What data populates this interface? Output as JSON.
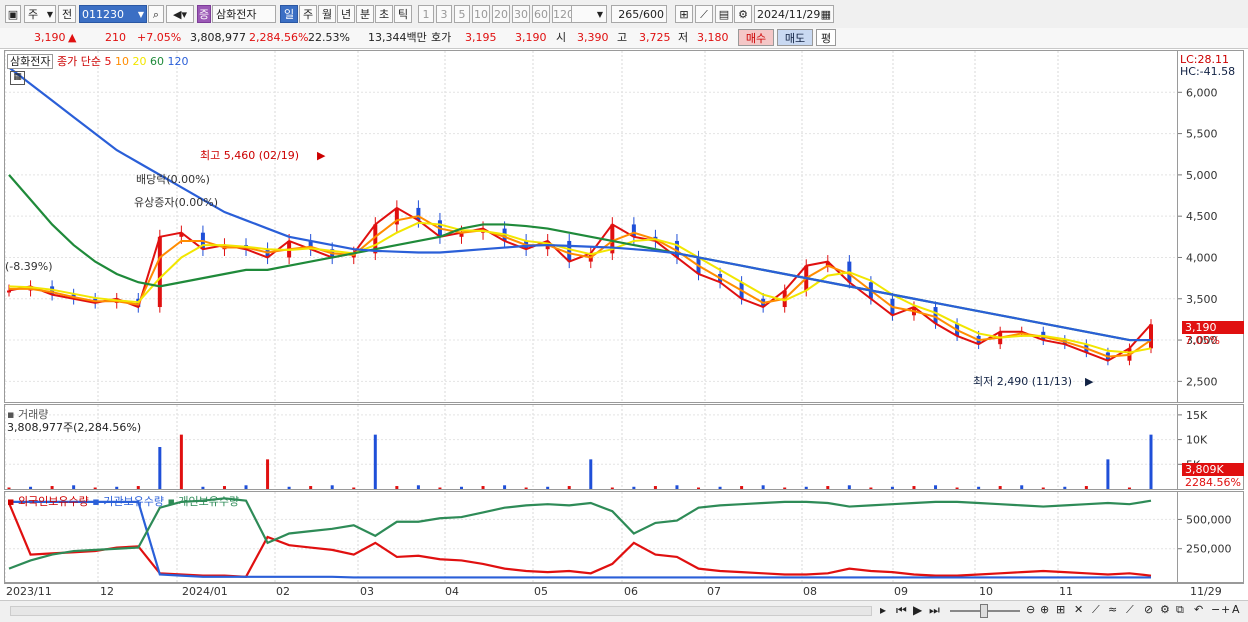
{
  "toolbar": {
    "market": "주",
    "prefix": "전",
    "code": "011230",
    "stock_name": "삼화전자",
    "badge": "증",
    "periods": [
      "일",
      "주",
      "월",
      "년",
      "분",
      "초",
      "틱"
    ],
    "selected_period": "일",
    "ranges": [
      "1",
      "3",
      "5",
      "10",
      "20",
      "30",
      "60",
      "120"
    ],
    "count": "265",
    "count_max": "/600",
    "date": "2024/11/29"
  },
  "info": {
    "price": "3,190",
    "arrow": "▲",
    "change": "210",
    "change_pct": "+7.05%",
    "volume": "3,808,977",
    "volume_ratio": "2,284.56%",
    "turnover": "22.53%",
    "amount": "13,344백만",
    "ask_label": "호가",
    "ask": "3,195",
    "bid": "3,190",
    "open_label": "시",
    "open": "3,390",
    "high_label": "고",
    "high": "3,725",
    "low_label": "저",
    "low": "3,180",
    "buy": "매수",
    "sell": "매도",
    "avg": "평"
  },
  "price_panel": {
    "name": "삼화전자",
    "indicator": "종가 단순",
    "ma_periods": [
      "5",
      "10",
      "20",
      "60",
      "120"
    ],
    "ma_colors": [
      "#e01010",
      "#ff8c00",
      "#f2e600",
      "#1f8a3a",
      "#2a5fd8"
    ],
    "lc": "LC:28.11",
    "hc": "HC:-41.58",
    "last_tag": "3,190",
    "last_pct": "7.05%",
    "annotations": {
      "high": "최고 5,460 (02/19)",
      "low": "최저 2,490 (11/13)",
      "dividend": "배당락(0.00%)",
      "rights": "유상증자(0.00%)",
      "left_pct": "(-8.39%)"
    }
  },
  "volume_panel": {
    "title": "거래량",
    "value": "3,808,977주(2,284.56%)",
    "last_tag": "3,809K",
    "last_pct": "2284.56%"
  },
  "holding_panel": {
    "series_names": [
      "외국인보유수량",
      "기관보유수량",
      "개인보유수량"
    ]
  },
  "chart_data": [
    {
      "type": "line",
      "title": "삼화전자",
      "x_labels": [
        "2023/11",
        "12",
        "2024/01",
        "02",
        "03",
        "04",
        "05",
        "06",
        "07",
        "08",
        "09",
        "10",
        "11",
        "11/29"
      ],
      "y_ticks": [
        2500,
        3000,
        3500,
        4000,
        4500,
        5000,
        5500,
        6000
      ],
      "ylim": [
        2250,
        6500
      ],
      "series": [
        {
          "name": "5",
          "color": "#e01010",
          "values": [
            3600,
            3650,
            3550,
            3500,
            3450,
            3500,
            3400,
            4250,
            4300,
            4100,
            4150,
            4100,
            4000,
            4200,
            4100,
            4000,
            4050,
            4400,
            4600,
            4450,
            4250,
            4300,
            4350,
            4200,
            4100,
            4200,
            3950,
            4050,
            4400,
            4250,
            4200,
            4000,
            3800,
            3700,
            3500,
            3400,
            3600,
            3900,
            3950,
            3700,
            3500,
            3300,
            3400,
            3200,
            3050,
            2950,
            3100,
            3100,
            3000,
            2950,
            2850,
            2750,
            2900,
            3190
          ]
        },
        {
          "name": "10",
          "color": "#ff8c00",
          "values": [
            3620,
            3620,
            3580,
            3520,
            3470,
            3470,
            3430,
            4000,
            4200,
            4200,
            4120,
            4120,
            4060,
            4100,
            4130,
            4050,
            4030,
            4250,
            4450,
            4500,
            4350,
            4300,
            4330,
            4250,
            4150,
            4150,
            4050,
            4000,
            4200,
            4300,
            4220,
            4080,
            3900,
            3750,
            3600,
            3450,
            3500,
            3750,
            3900,
            3800,
            3600,
            3400,
            3350,
            3280,
            3120,
            3000,
            3030,
            3080,
            3040,
            2980,
            2900,
            2800,
            2820,
            3000
          ]
        },
        {
          "name": "20",
          "color": "#f2e600",
          "values": [
            3650,
            3640,
            3610,
            3560,
            3510,
            3480,
            3460,
            3750,
            4000,
            4150,
            4150,
            4130,
            4100,
            4090,
            4110,
            4080,
            4050,
            4150,
            4300,
            4420,
            4400,
            4330,
            4320,
            4280,
            4200,
            4170,
            4100,
            4040,
            4100,
            4200,
            4220,
            4150,
            4000,
            3850,
            3700,
            3550,
            3480,
            3600,
            3780,
            3820,
            3720,
            3550,
            3420,
            3330,
            3200,
            3080,
            3030,
            3050,
            3050,
            3010,
            2950,
            2870,
            2850,
            2900
          ]
        },
        {
          "name": "60",
          "color": "#1f8a3a",
          "values": [
            5000,
            4700,
            4400,
            4150,
            3950,
            3800,
            3700,
            3650,
            3700,
            3750,
            3800,
            3850,
            3850,
            3900,
            3950,
            4000,
            4050,
            4100,
            4150,
            4200,
            4250,
            4350,
            4400,
            4400,
            4380,
            4350,
            4300,
            4250,
            4200,
            4150,
            4100,
            4050,
            4000,
            3950,
            3900,
            3850,
            3800,
            3750,
            3700,
            3650,
            3600,
            3550,
            3500,
            3450,
            3400,
            3350,
            3300,
            3250,
            3200,
            3150,
            3100,
            3050,
            3000,
            3000
          ]
        },
        {
          "name": "120",
          "color": "#2a5fd8",
          "values": [
            6300,
            6100,
            5900,
            5700,
            5500,
            5300,
            5150,
            5000,
            4850,
            4700,
            4550,
            4450,
            4350,
            4250,
            4200,
            4150,
            4100,
            4080,
            4070,
            4060,
            4060,
            4080,
            4100,
            4120,
            4140,
            4150,
            4140,
            4130,
            4120,
            4100,
            4080,
            4050,
            4000,
            3950,
            3900,
            3850,
            3800,
            3750,
            3700,
            3650,
            3600,
            3550,
            3500,
            3450,
            3400,
            3350,
            3300,
            3250,
            3200,
            3150,
            3100,
            3050,
            3000,
            3000
          ]
        }
      ]
    },
    {
      "type": "bar",
      "title": "거래량",
      "y_ticks": [
        5000,
        10000,
        15000
      ],
      "ylim": [
        0,
        17000
      ]
    },
    {
      "type": "line",
      "y_ticks": [
        250000,
        500000
      ],
      "ylim": [
        0,
        700000
      ],
      "series": [
        {
          "name": "외국인보유수량",
          "color": "#e01010",
          "values": [
            640000,
            200000,
            210000,
            220000,
            230000,
            260000,
            270000,
            40000,
            30000,
            20000,
            20000,
            10000,
            350000,
            280000,
            260000,
            240000,
            200000,
            300000,
            180000,
            190000,
            160000,
            150000,
            120000,
            80000,
            60000,
            50000,
            60000,
            40000,
            120000,
            300000,
            200000,
            180000,
            80000,
            60000,
            50000,
            40000,
            30000,
            30000,
            40000,
            80000,
            60000,
            50000,
            30000,
            20000,
            20000,
            30000,
            40000,
            50000,
            60000,
            50000,
            40000,
            30000,
            40000,
            20000
          ]
        },
        {
          "name": "기관보유수량",
          "color": "#2a5fd8",
          "values": [
            650000,
            650000,
            650000,
            650000,
            650000,
            650000,
            650000,
            30000,
            20000,
            10000,
            10000,
            10000,
            10000,
            10000,
            10000,
            10000,
            5000,
            5000,
            5000,
            5000,
            5000,
            5000,
            5000,
            5000,
            5000,
            5000,
            5000,
            5000,
            5000,
            5000,
            5000,
            5000,
            5000,
            5000,
            5000,
            5000,
            5000,
            5000,
            5000,
            5000,
            5000,
            5000,
            5000,
            5000,
            5000,
            5000,
            5000,
            5000,
            5000,
            5000,
            5000,
            5000,
            5000,
            5000
          ]
        },
        {
          "name": "개인보유수량",
          "color": "#2e8b57",
          "values": [
            80000,
            150000,
            200000,
            230000,
            240000,
            250000,
            260000,
            600000,
            650000,
            660000,
            680000,
            660000,
            300000,
            380000,
            400000,
            420000,
            450000,
            360000,
            480000,
            480000,
            510000,
            520000,
            560000,
            600000,
            620000,
            630000,
            620000,
            640000,
            570000,
            380000,
            470000,
            490000,
            600000,
            620000,
            630000,
            640000,
            650000,
            650000,
            640000,
            610000,
            620000,
            630000,
            640000,
            650000,
            650000,
            640000,
            630000,
            620000,
            610000,
            620000,
            630000,
            640000,
            630000,
            660000
          ]
        }
      ]
    }
  ]
}
